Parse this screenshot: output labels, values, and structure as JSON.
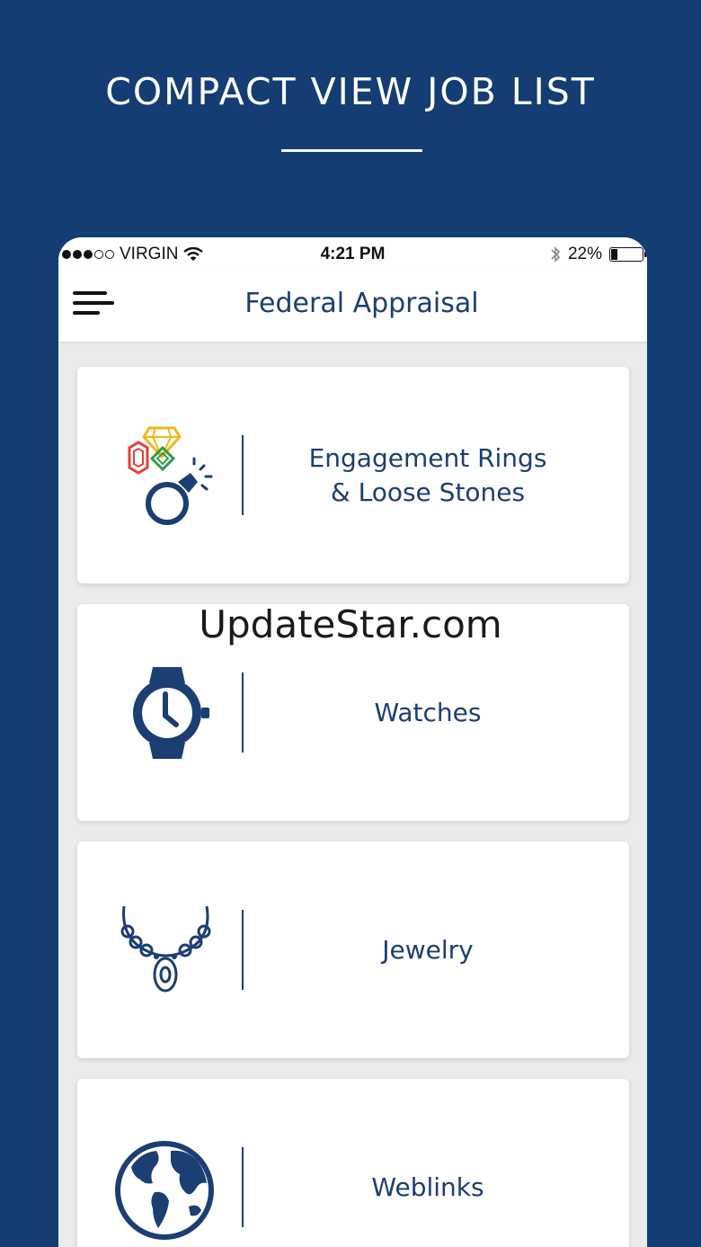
{
  "banner": {
    "title": "COMPACT VIEW JOB LIST"
  },
  "status_bar": {
    "carrier": "VIRGIN",
    "time": "4:21 PM",
    "battery": "22%"
  },
  "nav": {
    "title": "Federal Appraisal",
    "menu_icon": "hamburger-menu-icon"
  },
  "categories": [
    {
      "label": "Engagement Rings\n& Loose Stones",
      "icon": "gemstones-ring-icon"
    },
    {
      "label": "Watches",
      "icon": "watch-icon"
    },
    {
      "label": "Jewelry",
      "icon": "necklace-icon"
    },
    {
      "label": "Weblinks",
      "icon": "globe-icon"
    }
  ],
  "watermark": "UpdateStar.com",
  "colors": {
    "background": "#133d73",
    "brand": "#1b3e73",
    "gem_red": "#e0413a",
    "gem_yellow": "#f0b71b",
    "gem_green": "#2f9e48"
  }
}
